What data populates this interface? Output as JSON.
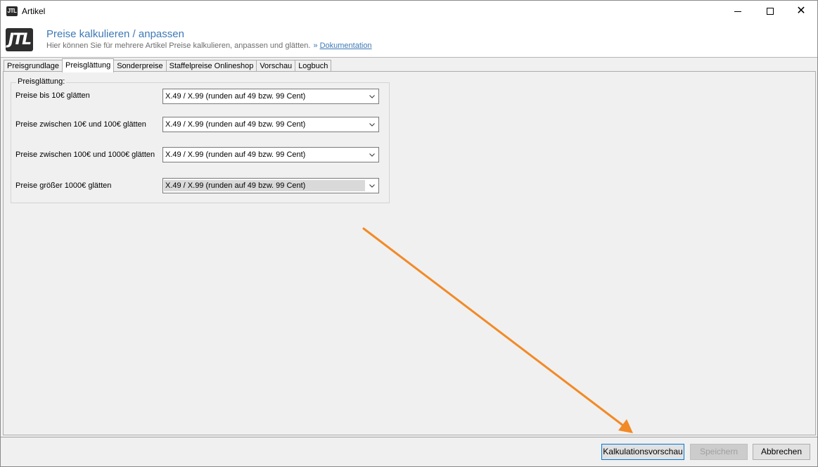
{
  "window": {
    "title": "Artikel",
    "app_icon": "jtl-app-icon"
  },
  "header": {
    "logo_text": "JTL",
    "title": "Preise kalkulieren / anpassen",
    "subtitle": "Hier können Sie für mehrere Artikel Preise kalkulieren, anpassen und glätten.",
    "link_prefix": "»",
    "link_text": "Dokumentation"
  },
  "tabs": [
    {
      "label": "Preisgrundlage"
    },
    {
      "label": "Preisglättung",
      "active": true
    },
    {
      "label": "Sonderpreise"
    },
    {
      "label": "Staffelpreise Onlineshop"
    },
    {
      "label": "Vorschau"
    },
    {
      "label": "Logbuch"
    }
  ],
  "group": {
    "legend": "Preisglättung:",
    "rows": [
      {
        "label": "Preise bis 10€ glätten",
        "value": "X.49 / X.99 (runden auf 49 bzw. 99 Cent)"
      },
      {
        "label": "Preise zwischen 10€ und 100€ glätten",
        "value": "X.49 / X.99 (runden auf 49 bzw. 99 Cent)"
      },
      {
        "label": "Preise zwischen 100€ und 1000€ glätten",
        "value": "X.49 / X.99 (runden auf 49 bzw. 99 Cent)"
      },
      {
        "label": "Preise größer 1000€ glätten",
        "value": "X.49 / X.99 (runden auf 49 bzw. 99 Cent)",
        "highlighted": true
      }
    ]
  },
  "buttons": {
    "preview": "Kalkulationsvorschau",
    "save": "Speichern",
    "cancel": "Abbrechen"
  },
  "colors": {
    "accent": "#3d79b6",
    "annotation_arrow": "#f28a26",
    "focus_border": "#0078d7"
  }
}
